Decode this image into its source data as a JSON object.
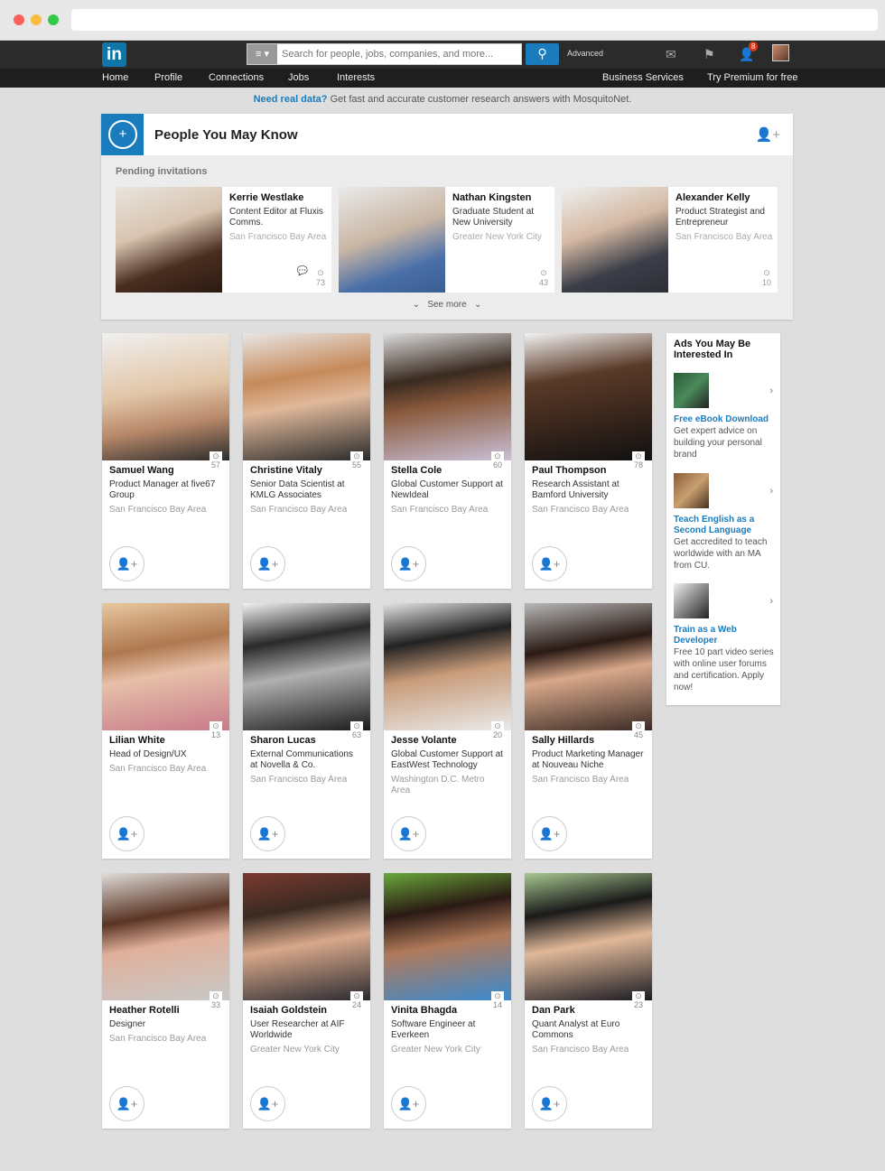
{
  "topbar": {
    "logo": "in",
    "search_placeholder": "Search for people, jobs, companies, and more...",
    "search_menu": "≡ ▾",
    "search_button": "⚲",
    "advanced": "Advanced",
    "notification_count": "8"
  },
  "nav": {
    "items": [
      "Home",
      "Profile",
      "Connections",
      "Jobs",
      "Interests"
    ],
    "business": "Business Services",
    "premium": "Try Premium for free"
  },
  "banner": {
    "link": "Need real data?",
    "text": " Get fast and accurate customer research answers with MosquitoNet."
  },
  "pymk": {
    "title": "People You May Know",
    "pending_label": "Pending invitations",
    "see_more": "See more",
    "invitations": [
      {
        "name": "Kerrie Westlake",
        "title": "Content Editor at Fluxis Comms.",
        "location": "San Francisco Bay Area",
        "count": "73"
      },
      {
        "name": "Nathan Kingsten",
        "title": "Graduate Student at New University",
        "location": "Greater New York City",
        "count": "43"
      },
      {
        "name": "Alexander Kelly",
        "title": "Product Strategist and Entrepreneur",
        "location": "San Francisco Bay Area",
        "count": "10"
      }
    ]
  },
  "people": [
    {
      "name": "Samuel Wang",
      "title": "Product Manager at five67 Group",
      "location": "San Francisco Bay Area",
      "count": "57"
    },
    {
      "name": "Christine Vitaly",
      "title": "Senior Data Scientist at KMLG Associates",
      "location": "San Francisco Bay Area",
      "count": "55"
    },
    {
      "name": "Stella Cole",
      "title": "Global Customer Support at NewIdeal",
      "location": "San Francisco Bay Area",
      "count": "60"
    },
    {
      "name": "Paul Thompson",
      "title": "Research Assistant at Bamford University",
      "location": "San Francisco Bay Area",
      "count": "78"
    },
    {
      "name": "Lilian White",
      "title": "Head of Design/UX",
      "location": "San Francisco Bay Area",
      "count": "13"
    },
    {
      "name": "Sharon Lucas",
      "title": "External Communications at Novella & Co.",
      "location": "San Francisco Bay Area",
      "count": "63"
    },
    {
      "name": "Jesse Volante",
      "title": "Global Customer Support at EastWest Technology",
      "location": "Washington D.C. Metro Area",
      "count": "20"
    },
    {
      "name": "Sally Hillards",
      "title": "Product Marketing Manager at Nouveau Niche",
      "location": "San Francisco Bay Area",
      "count": "45"
    },
    {
      "name": "Heather Rotelli",
      "title": "Designer",
      "location": "San Francisco Bay Area",
      "count": "33"
    },
    {
      "name": "Isaiah Goldstein",
      "title": "User Researcher at AIF Worldwide",
      "location": "Greater New York City",
      "count": "24"
    },
    {
      "name": "Vinita Bhagda",
      "title": "Software Engineer at Everkeen",
      "location": "Greater New York City",
      "count": "14"
    },
    {
      "name": "Dan Park",
      "title": "Quant Analyst at Euro Commons",
      "location": "San Francisco Bay Area",
      "count": "23"
    }
  ],
  "ads": {
    "title": "Ads You May Be Interested In",
    "items": [
      {
        "headline": "Free eBook Download",
        "body": "Get expert advice on building your personal brand"
      },
      {
        "headline": "Teach English as a Second Language",
        "body": "Get accredited to teach worldwide with an MA from CU."
      },
      {
        "headline": "Train as a Web Developer",
        "body": "Free 10 part video series with online user forums and certification. Apply now!"
      }
    ]
  }
}
